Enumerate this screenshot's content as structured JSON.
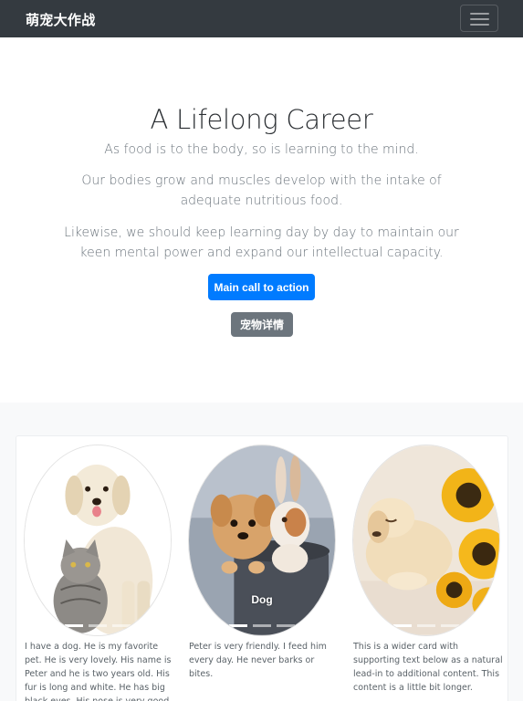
{
  "navbar": {
    "brand": "萌宠大作战"
  },
  "hero": {
    "title": "A Lifelong Career",
    "lead1": "As food is to the body, so is learning to the mind.",
    "lead2": "Our bodies grow and muscles develop with the intake of adequate nutritious food.",
    "lead3": "Likewise, we should keep learning day by day to maintain our keen mental power and expand our intellectual capacity.",
    "primary_button": "Main call to action",
    "secondary_button": "宠物详情"
  },
  "cards": [
    {
      "text": "I have a dog. He is my favorite pet. He is very lovely. His name is Peter and he is two years old. His fur is long and white. He has big black eyes. His nose is very good. He can"
    },
    {
      "caption": "Dog",
      "text": "Peter is very friendly. I feed him every day. He never barks or bites."
    },
    {
      "text": "This is a wider card with supporting text below as a natural lead-in to additional content. This content is a little bit longer."
    }
  ],
  "colors": {
    "navbar_bg": "#343a40",
    "primary": "#007bff",
    "secondary": "#6c757d",
    "album_bg": "#f8f9fa"
  }
}
